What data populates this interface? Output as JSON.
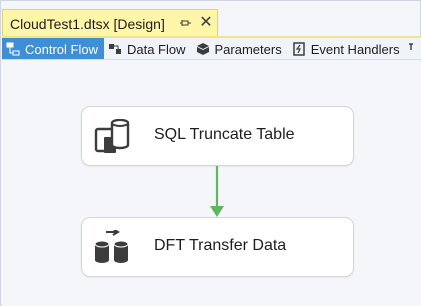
{
  "document_tab": {
    "title": "CloudTest1.dtsx [Design]",
    "pin_icon": "pin-icon",
    "close_glyph": "✕"
  },
  "designer_tabs": [
    {
      "label": "Control Flow",
      "icon": "control-flow-icon",
      "active": true
    },
    {
      "label": "Data Flow",
      "icon": "data-flow-icon",
      "active": false
    },
    {
      "label": "Parameters",
      "icon": "parameters-icon",
      "active": false
    },
    {
      "label": "Event Handlers",
      "icon": "event-handlers-icon",
      "active": false
    }
  ],
  "tasks": [
    {
      "label": "SQL Truncate Table",
      "icon": "execute-sql-task-icon"
    },
    {
      "label": "DFT Transfer Data",
      "icon": "data-flow-task-icon"
    }
  ],
  "colors": {
    "tab_background": "#fff6a8",
    "active_subtab": "#3e8fd6",
    "precedence_constraint": "#5cb85c",
    "canvas": "#f4f6fa"
  }
}
